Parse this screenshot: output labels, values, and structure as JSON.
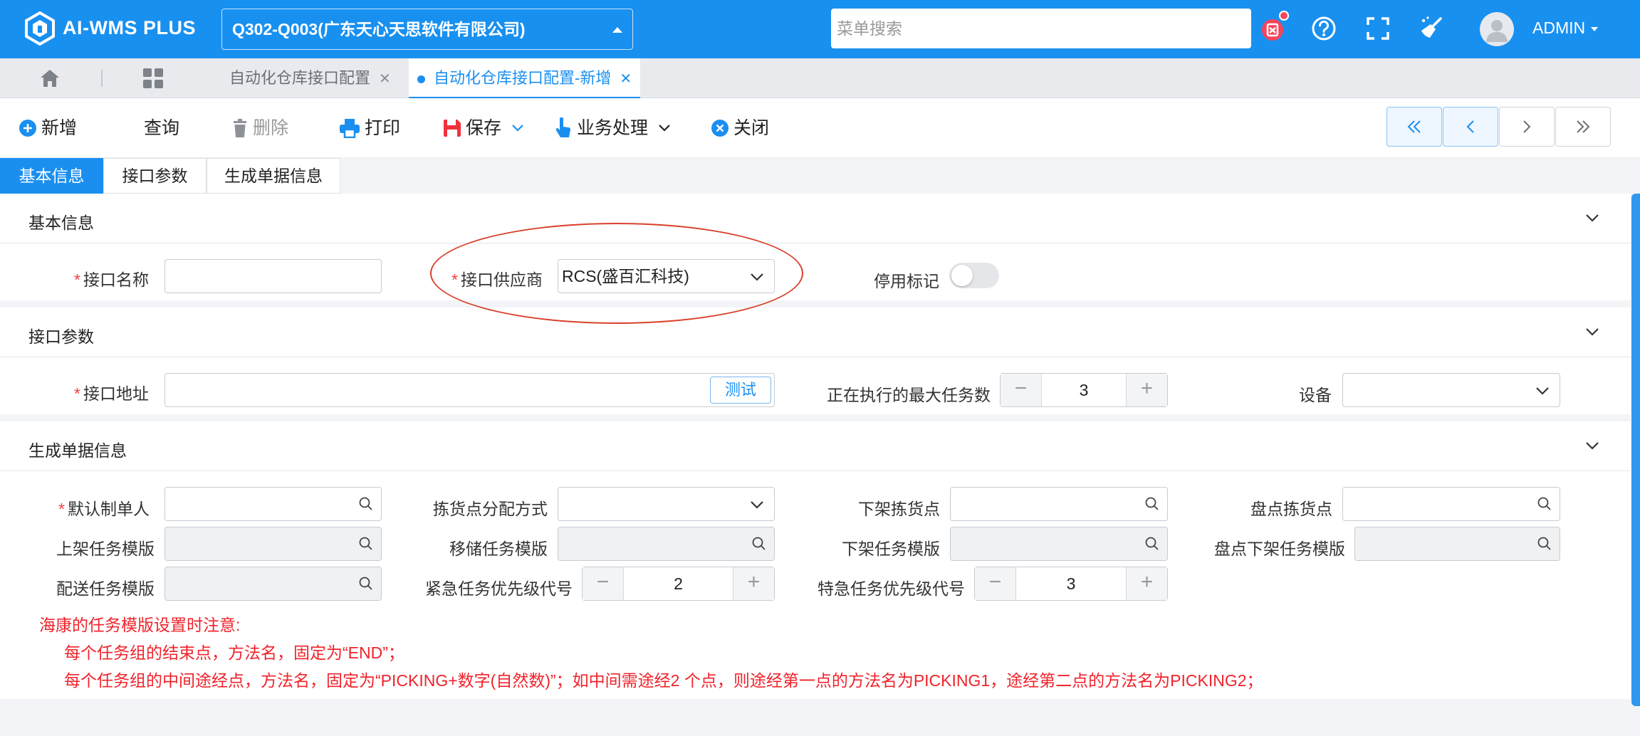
{
  "header": {
    "logo_text": "AI-WMS PLUS",
    "company": "Q302-Q003(广东天心天思软件有限公司)",
    "menu_search_placeholder": "菜单搜索",
    "user": "ADMIN",
    "colors": {
      "brand": "#1890f0",
      "badge": "#f5455b"
    },
    "icons": [
      "clear-cache-icon",
      "help-icon",
      "fullscreen-icon",
      "broom-icon"
    ]
  },
  "page_tabs": [
    {
      "label": "自动化仓库接口配置",
      "active": false
    },
    {
      "label": "自动化仓库接口配置-新增",
      "active": true
    }
  ],
  "toolbar": {
    "add": "新增",
    "query": "查询",
    "delete": "删除",
    "print": "打印",
    "save": "保存",
    "business": "业务处理",
    "close": "关闭"
  },
  "detail_tabs": [
    "基本信息",
    "接口参数",
    "生成单据信息"
  ],
  "basic": {
    "title": "基本信息",
    "name_label": "接口名称",
    "name_value": "",
    "vendor_label": "接口供应商",
    "vendor_value": "RCS(盛百汇科技)",
    "disabled_label": "停用标记"
  },
  "params": {
    "title": "接口参数",
    "url_label": "接口地址",
    "url_value": "",
    "test_button": "测试",
    "max_tasks_label": "正在执行的最大任务数",
    "max_tasks_value": "3",
    "device_label": "设备",
    "device_value": ""
  },
  "doc": {
    "title": "生成单据信息",
    "creator_label": "默认制单人",
    "pick_alloc_label": "拣货点分配方式",
    "unload_pick_label": "下架拣货点",
    "count_pick_label": "盘点拣货点",
    "putaway_tpl_label": "上架任务模版",
    "move_tpl_label": "移储任务模版",
    "unload_tpl_label": "下架任务模版",
    "count_unload_tpl_label": "盘点下架任务模版",
    "delivery_tpl_label": "配送任务模版",
    "urgent_label": "紧急任务优先级代号",
    "urgent_value": "2",
    "special_label": "特急任务优先级代号",
    "special_value": "3"
  },
  "notes": {
    "title": "海康的任务模版设置时注意:",
    "line1": "每个任务组的结束点，方法名，固定为“END”；",
    "line2": "每个任务组的中间途经点，方法名，固定为“PICKING+数字(自然数)”；如中间需途经2 个点，则途经第一点的方法名为PICKING1，途经第二点的方法名为PICKING2；"
  }
}
